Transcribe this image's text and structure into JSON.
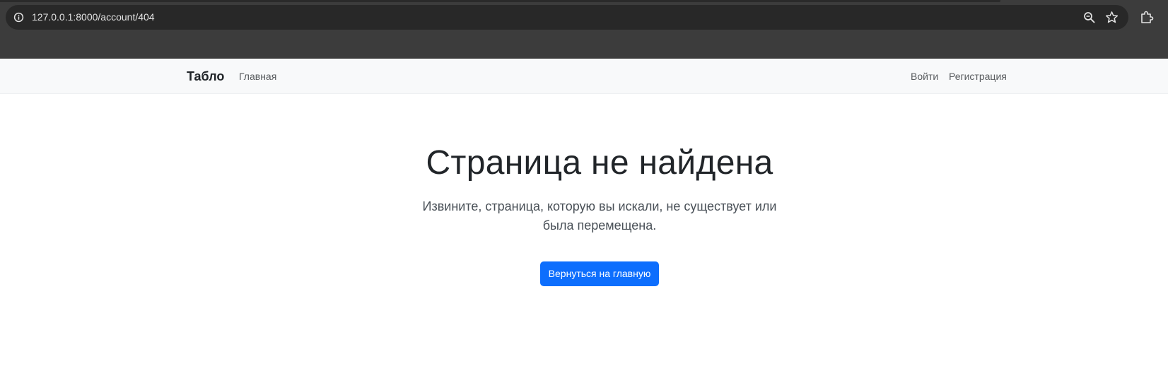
{
  "browser": {
    "url": "127.0.0.1:8000/account/404",
    "icons": [
      "info-icon",
      "zoom-icon",
      "star-icon",
      "extensions-icon"
    ]
  },
  "navbar": {
    "brand": "Табло",
    "home": "Главная",
    "login": "Войти",
    "register": "Регистрация"
  },
  "main": {
    "title": "Страница не найдена",
    "lead": "Извините, страница, которую вы искали, не существует или была перемещена.",
    "button": "Вернуться на главную"
  },
  "colors": {
    "chrome": "#3c3c3c",
    "omnibox": "#282828",
    "navbar": "#f8f9fa",
    "primary": "#0d6efd",
    "text": "#212529"
  }
}
